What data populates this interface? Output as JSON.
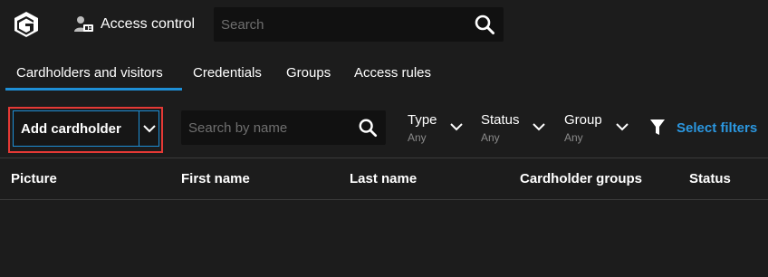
{
  "app": {
    "title": "Access control",
    "icon": "cardholder-icon",
    "logo": "genetec-logo-icon"
  },
  "global_search": {
    "placeholder": "Search",
    "icon": "search-icon"
  },
  "tabs": [
    {
      "label": "Cardholders and visitors",
      "active": true
    },
    {
      "label": "Credentials",
      "active": false
    },
    {
      "label": "Groups",
      "active": false
    },
    {
      "label": "Access rules",
      "active": false
    }
  ],
  "toolbar": {
    "add_label": "Add cardholder",
    "name_search_placeholder": "Search by name",
    "filters": [
      {
        "label": "Type",
        "value": "Any"
      },
      {
        "label": "Status",
        "value": "Any"
      },
      {
        "label": "Group",
        "value": "Any"
      }
    ],
    "select_filters_label": "Select filters"
  },
  "table": {
    "columns": [
      "Picture",
      "First name",
      "Last name",
      "Cardholder groups",
      "Status"
    ],
    "rows": []
  },
  "colors": {
    "accent": "#1e8fd6",
    "link": "#2b97e0",
    "highlight": "#e53935",
    "background": "#1c1c1c"
  }
}
